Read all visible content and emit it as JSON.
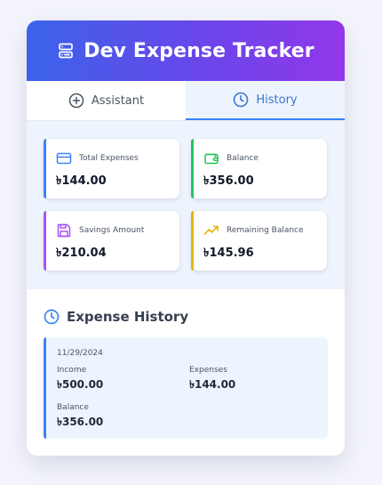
{
  "app": {
    "title": "Dev Expense Tracker",
    "header_icon": "server-icon"
  },
  "tabs": [
    {
      "label": "Assistant",
      "icon": "plus-circle-icon",
      "active": false
    },
    {
      "label": "History",
      "icon": "clock-icon",
      "active": true
    }
  ],
  "summary": {
    "cards": [
      {
        "label": "Total Expenses",
        "value": "৳144.00",
        "icon": "credit-card-icon",
        "accent": "#3b82f6"
      },
      {
        "label": "Balance",
        "value": "৳356.00",
        "icon": "wallet-icon",
        "accent": "#22c55e"
      },
      {
        "label": "Savings Amount",
        "value": "৳210.04",
        "icon": "save-icon",
        "accent": "#a855f7"
      },
      {
        "label": "Remaining Balance",
        "value": "৳145.96",
        "icon": "trending-up-icon",
        "accent": "#eab308"
      }
    ]
  },
  "history": {
    "title": "Expense History",
    "entries": [
      {
        "date": "11/29/2024",
        "income_label": "Income",
        "income": "৳500.00",
        "expenses_label": "Expenses",
        "expenses": "৳144.00",
        "balance_label": "Balance",
        "balance": "৳356.00"
      }
    ]
  },
  "colors": {
    "header_gradient": [
      "#3b63eb",
      "#9137ea"
    ],
    "active_tab": "#3b82f6",
    "panel_background": "#eef4fd"
  }
}
